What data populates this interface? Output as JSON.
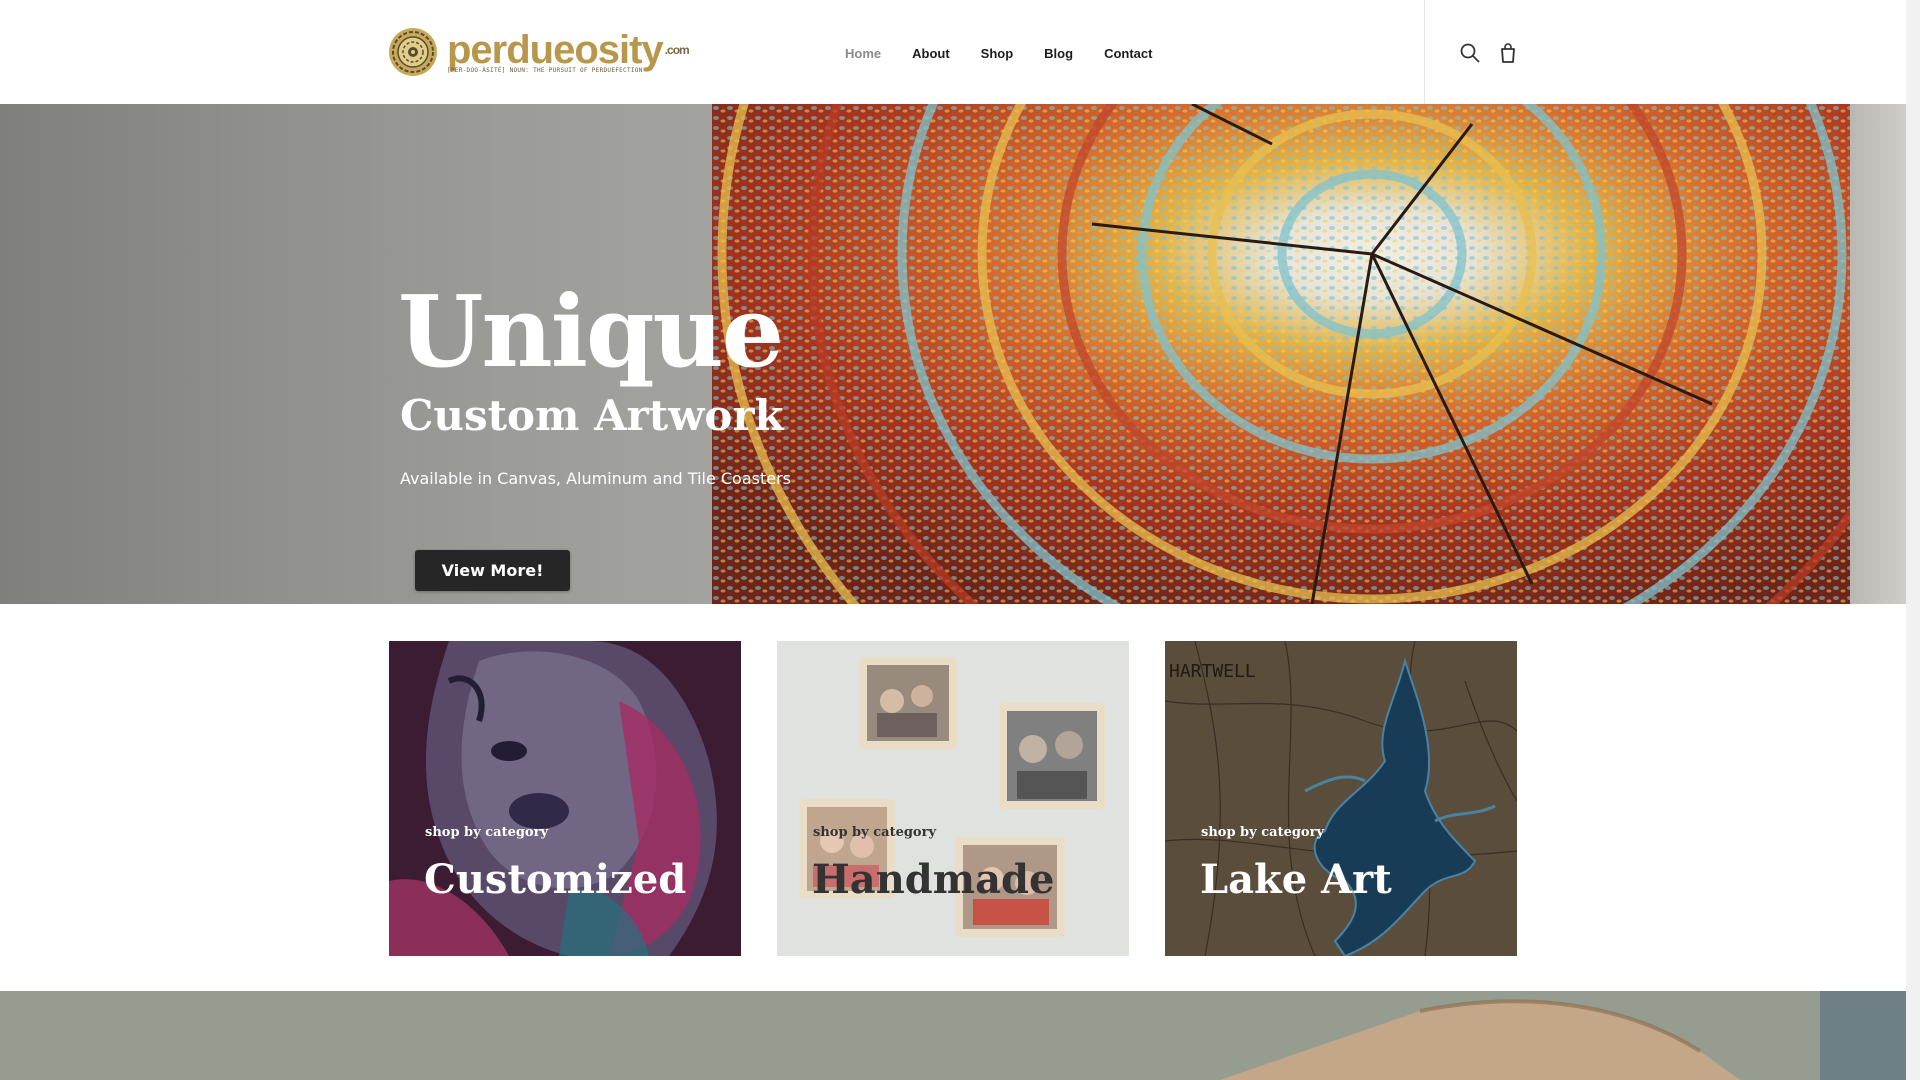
{
  "brand": {
    "name": "perdueosity",
    "suffix": ".com",
    "tagline": "[PER-DOO-ÀSITÉ] NOUN: THE PURSUIT OF PERDUEFECTION",
    "gold": "#b9974a"
  },
  "nav": {
    "items": [
      {
        "label": "Home",
        "active": true
      },
      {
        "label": "About",
        "active": false
      },
      {
        "label": "Shop",
        "active": false
      },
      {
        "label": "Blog",
        "active": false
      },
      {
        "label": "Contact",
        "active": false
      }
    ],
    "icons": [
      "search-icon",
      "shopping-bag-icon"
    ]
  },
  "hero": {
    "title": "Unique",
    "subtitle": "Custom Artwork",
    "description": "Available in Canvas, Aluminum and Tile Coasters",
    "button_label": "View More!"
  },
  "categories": [
    {
      "kicker": "shop by category",
      "title": "Customized"
    },
    {
      "kicker": "shop by category",
      "title": "Handmade"
    },
    {
      "kicker": "shop by category",
      "title": "Lake Art"
    }
  ],
  "lake_art_map_label": "HARTWELL",
  "colors": {
    "button_bg": "#262626",
    "nav_active": "#8b8b8b",
    "nav_text": "#1d1d1d"
  }
}
